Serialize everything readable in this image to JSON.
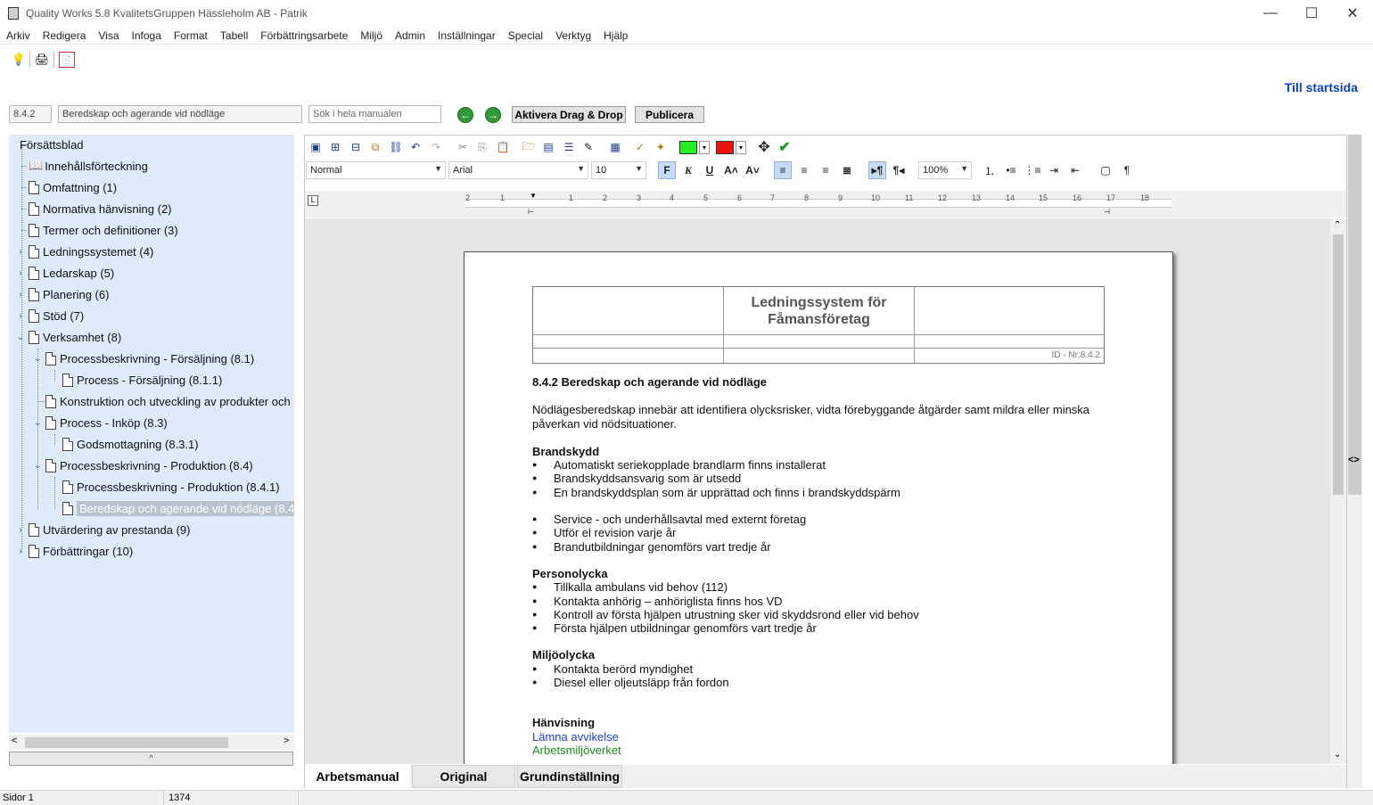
{
  "window": {
    "title": "Quality Works 5.8 KvalitetsGruppen Hässleholm AB - Patrik",
    "minimize": "—",
    "maximize": "☐",
    "close": "✕"
  },
  "menu": [
    "Arkiv",
    "Redigera",
    "Visa",
    "Infoga",
    "Format",
    "Tabell",
    "Förbättringsarbete",
    "Miljö",
    "Admin",
    "Inställningar",
    "Special",
    "Verktyg",
    "Hjälp"
  ],
  "toolbar": {
    "bulb": "💡",
    "print": "🖨",
    "pdf": "📄"
  },
  "nav": {
    "section_no": "8.4.2",
    "section_title": "Beredskap och agerande vid nödläge",
    "search_placeholder": "Sök i hela manualen",
    "back": "←",
    "forward": "→",
    "drag_drop": "Aktivera Drag & Drop",
    "publish": "Publicera",
    "home_link": "Till startsida"
  },
  "tree": {
    "items": [
      {
        "label": "Försättsblad"
      },
      {
        "label": "Innehållsförteckning"
      },
      {
        "label": "Omfattning (1)"
      },
      {
        "label": "Normativa hänvisning (2)"
      },
      {
        "label": "Termer och definitioner (3)"
      },
      {
        "label": "Ledningssystemet (4)"
      },
      {
        "label": "Ledarskap (5)"
      },
      {
        "label": "Planering (6)"
      },
      {
        "label": "Stöd (7)"
      },
      {
        "label": "Verksamhet (8)"
      },
      {
        "label": "Processbeskrivning - Försäljning (8.1)"
      },
      {
        "label": "Process - Försäljning (8.1.1)"
      },
      {
        "label": "Konstruktion och utveckling av produkter och"
      },
      {
        "label": "Process - Inköp (8.3)"
      },
      {
        "label": "Godsmottagning (8.3.1)"
      },
      {
        "label": "Processbeskrivning - Produktion (8.4)"
      },
      {
        "label": "Processbeskrivning - Produktion (8.4.1)"
      },
      {
        "label": "Beredskap och agerande vid nödläge (8.4"
      },
      {
        "label": "Utvärdering av prestanda (9)"
      },
      {
        "label": "Förbättringar (10)"
      }
    ],
    "scroll_left": "<",
    "scroll_right": ">",
    "collapse": "^"
  },
  "format": {
    "style": "Normal",
    "font": "Arial",
    "size": "10",
    "zoom": "100%",
    "bold": "F",
    "italic": "K",
    "underline": "U",
    "pilcrow": "¶",
    "text_color": "#22ee22",
    "highlight_color": "#ee1111"
  },
  "ruler": {
    "numbers": [
      "2",
      "1",
      "1",
      "2",
      "3",
      "4",
      "5",
      "6",
      "7",
      "8",
      "9",
      "10",
      "11",
      "12",
      "13",
      "14",
      "15",
      "16",
      "17",
      "18"
    ]
  },
  "document": {
    "header_title": "Ledningssystem för\nFåmansföretag",
    "id_label": "ID - Nr:8.4.2",
    "heading": "8.4.2 Beredskap och agerande vid nödläge",
    "intro": "Nödlägesberedskap innebär att identifiera olycksrisker, vidta förebyggande åtgärder samt mildra eller minska påverkan vid nödsituationer.",
    "sections": [
      {
        "title": "Brandskydd",
        "items": [
          "Automatiskt seriekopplade brandlarm finns installerat",
          "Brandskyddsansvarig som är utsedd",
          "En brandskyddsplan som är upprättad och finns i brandskyddspärm"
        ],
        "items2": [
          "Service - och underhållsavtal med externt företag",
          "Utför el revision varje år",
          "Brandutbildningar genomförs vart tredje år"
        ]
      },
      {
        "title": "Personolycka",
        "items": [
          "Tillkalla ambulans vid behov (112)",
          "Kontakta anhörig – anhöriglista finns hos VD",
          "Kontroll av första hjälpen utrustning sker vid skyddsrond eller vid behov",
          "Första hjälpen utbildningar genomförs vart tredje år"
        ]
      },
      {
        "title": "Miljöolycka",
        "items": [
          "Kontakta berörd myndighet",
          "Diesel eller oljeutsläpp från fordon"
        ]
      }
    ],
    "ref_title": "Hänvisning",
    "ref_link1": "Lämna avvikelse",
    "ref_link2": "Arbetsmiljöverket"
  },
  "tabs": [
    "Arbetsmanual",
    "Original",
    "Grundinställning"
  ],
  "status": {
    "pages": "Sidor 1",
    "value": "1374"
  }
}
